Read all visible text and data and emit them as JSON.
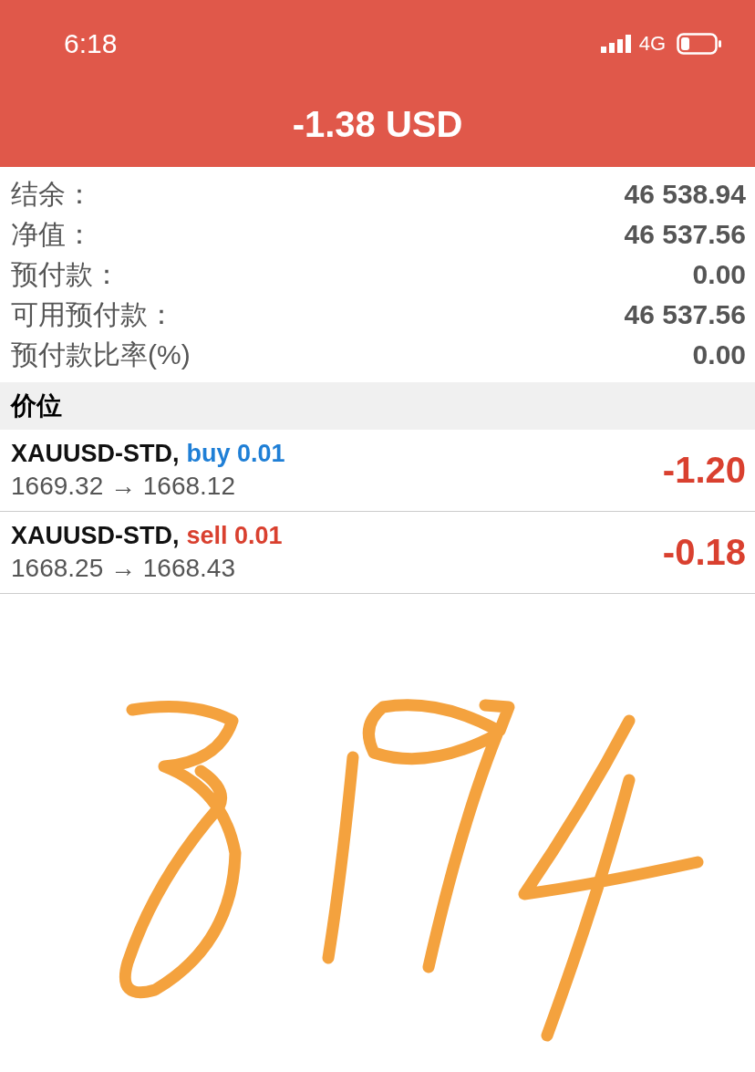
{
  "status_bar": {
    "time": "6:18",
    "network": "4G"
  },
  "header": {
    "title": "-1.38 USD"
  },
  "account": [
    {
      "label": "结余：",
      "value": "46 538.94"
    },
    {
      "label": "净值：",
      "value": "46 537.56"
    },
    {
      "label": "预付款：",
      "value": "0.00"
    },
    {
      "label": "可用预付款：",
      "value": "46 537.56"
    },
    {
      "label": "预付款比率(%)",
      "value": "0.00"
    }
  ],
  "section": {
    "title": "价位"
  },
  "positions": [
    {
      "symbol": "XAUUSD-STD,",
      "kind": "buy",
      "side_label": "buy 0.01",
      "prices": "1669.32 → 1668.12",
      "profit": "-1.20"
    },
    {
      "symbol": "XAUUSD-STD,",
      "kind": "sell",
      "side_label": "sell 0.01",
      "prices": "1668.25 → 1668.43",
      "profit": "-0.18"
    }
  ]
}
